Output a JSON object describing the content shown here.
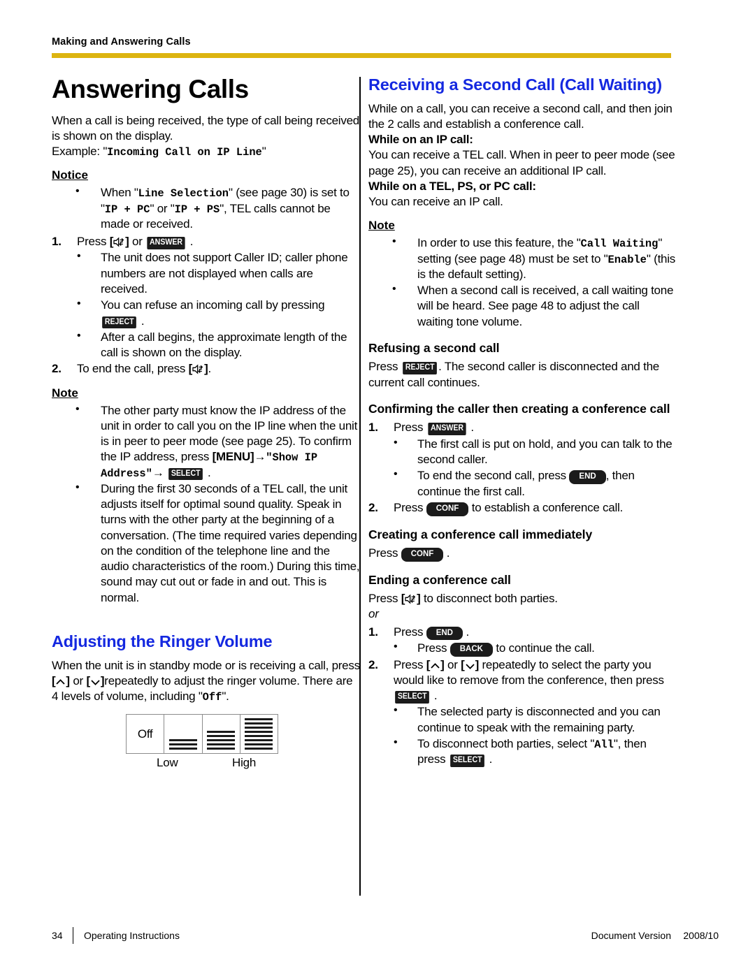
{
  "header": {
    "running_head": "Making and Answering Calls",
    "rule_color": "#DCB410"
  },
  "theme": {
    "heading_blue": "#1428E0",
    "key_badge_bg": "#1b1b1b",
    "key_badge_fg": "#ffffff"
  },
  "keys": {
    "answer": "ANSWER",
    "reject": "REJECT",
    "select": "SELECT",
    "conf": "CONF",
    "end": "END",
    "back": "BACK",
    "menu": "[MENU]"
  },
  "left_column": {
    "chapter_title": "Answering Calls",
    "intro": "When a call is being received, the type of call being received is shown on the display.",
    "example_prefix": "Example: \"",
    "example_lcd": "Incoming Call on IP Line",
    "example_suffix": "\"",
    "notice_label": "Notice",
    "notice_bullets": [
      {
        "p1": "When \"",
        "lcd1": "Line Selection",
        "p2": "\" (see page 30) is set to \"",
        "lcd2": "IP + PC",
        "p3": "\" or \"",
        "lcd3": "IP + PS",
        "p4": "\", TEL calls cannot be made or received."
      }
    ],
    "step1_prefix": "Press",
    "step1_or": "or",
    "step1_suffix": ".",
    "step1_bullets": [
      "The unit does not support Caller ID; caller phone numbers are not displayed when calls are received.",
      "You can refuse an incoming call by pressing",
      "After a call begins, the approximate length of the call is shown on the display."
    ],
    "step2": "To end the call, press",
    "step2_suffix": ".",
    "note_label": "Note",
    "note_bullet_1_a": "The other party must know the IP address of the unit in order to call you on the IP line when the unit is in peer to peer mode (see page 25). To confirm the IP address, press",
    "note_bullet_1_menu": "[MENU]",
    "note_bullet_1_arrow": "→",
    "note_bullet_1_lcd1": "\"Show IP Address\"",
    "note_bullet_1_end": ".",
    "note_bullet_2": "During the first 30 seconds of a TEL call, the unit adjusts itself for optimal sound quality. Speak in turns with the other party at the beginning of a conversation. (The time required varies depending on the condition of the telephone line and the audio characteristics of the room.) During this time, sound may cut out or fade in and out. This is normal.",
    "ringer_heading": "Adjusting the Ringer Volume",
    "ringer_body_a": "When the unit is in standby mode or is receiving a call, press",
    "ringer_body_or": "or",
    "ringer_body_b": "repeatedly to adjust the ringer volume. There are 4 levels of volume, including \"",
    "ringer_body_lcd": "Off",
    "ringer_body_c": "\".",
    "volume_figure": {
      "off_label": "Off",
      "low_label": "Low",
      "high_label": "High",
      "levels": [
        0,
        3,
        5,
        8
      ]
    }
  },
  "right_column": {
    "heading": "Receiving a Second Call (Call Waiting)",
    "intro": "While on a call, you can receive a second call, and then join the 2 calls and establish a conference call.",
    "ip_call_label": "While on an IP call:",
    "ip_call_body": "You can receive a TEL call. When in peer to peer mode (see page 25), you can receive an additional IP call.",
    "tel_call_label": "While on a TEL, PS, or PC call:",
    "tel_call_body": "You can receive an IP call.",
    "note_label": "Note",
    "note_bullet_1_a": "In order to use this feature, the \"",
    "note_bullet_1_lcd1": "Call Waiting",
    "note_bullet_1_b": "\" setting (see page 48) must be set to \"",
    "note_bullet_1_lcd2": "Enable",
    "note_bullet_1_c": "\" (this is the default setting).",
    "note_bullet_2": "When a second call is received, a call waiting tone will be heard. See page 48 to adjust the call waiting tone volume.",
    "refusing_heading": "Refusing a second call",
    "refusing_a": "Press",
    "refusing_b": ". The second caller is disconnected and the current call continues.",
    "confirming_heading": "Confirming the caller then creating a conference call",
    "confirm_step1": "Press",
    "confirm_step1_suffix": ".",
    "confirm_bullets": [
      "The first call is put on hold, and you can talk to the second caller.",
      "To end the second call, press"
    ],
    "confirm_bullet2_tail": ", then continue the first call.",
    "confirm_step2_a": "Press",
    "confirm_step2_b": "to establish a conference call.",
    "creating_heading": "Creating a conference call immediately",
    "creating_press": "Press",
    "creating_suffix": ".",
    "ending_heading": "Ending a conference call",
    "ending_press_a": "Press",
    "ending_press_b": "to disconnect both parties.",
    "ending_or": "or",
    "ending_step1": "Press",
    "ending_step1_suffix": ".",
    "ending_step1_bullet_a": "Press",
    "ending_step1_bullet_b": "to continue the call.",
    "ending_step2_a": "Press",
    "ending_step2_or": "or",
    "ending_step2_b": "repeatedly to select the party you would like to remove from the conference, then press",
    "ending_step2_suffix": ".",
    "ending_step2_bullets": [
      "The selected party is disconnected and you can continue to speak with the remaining party.",
      "To disconnect both parties, select \""
    ],
    "ending_last_lcd": "All",
    "ending_last_tail": "\", then press",
    "ending_last_suffix": "."
  },
  "footer": {
    "page_number": "34",
    "doc_title": "Operating Instructions",
    "version_label": "Document Version",
    "version_value": "2008/10"
  }
}
